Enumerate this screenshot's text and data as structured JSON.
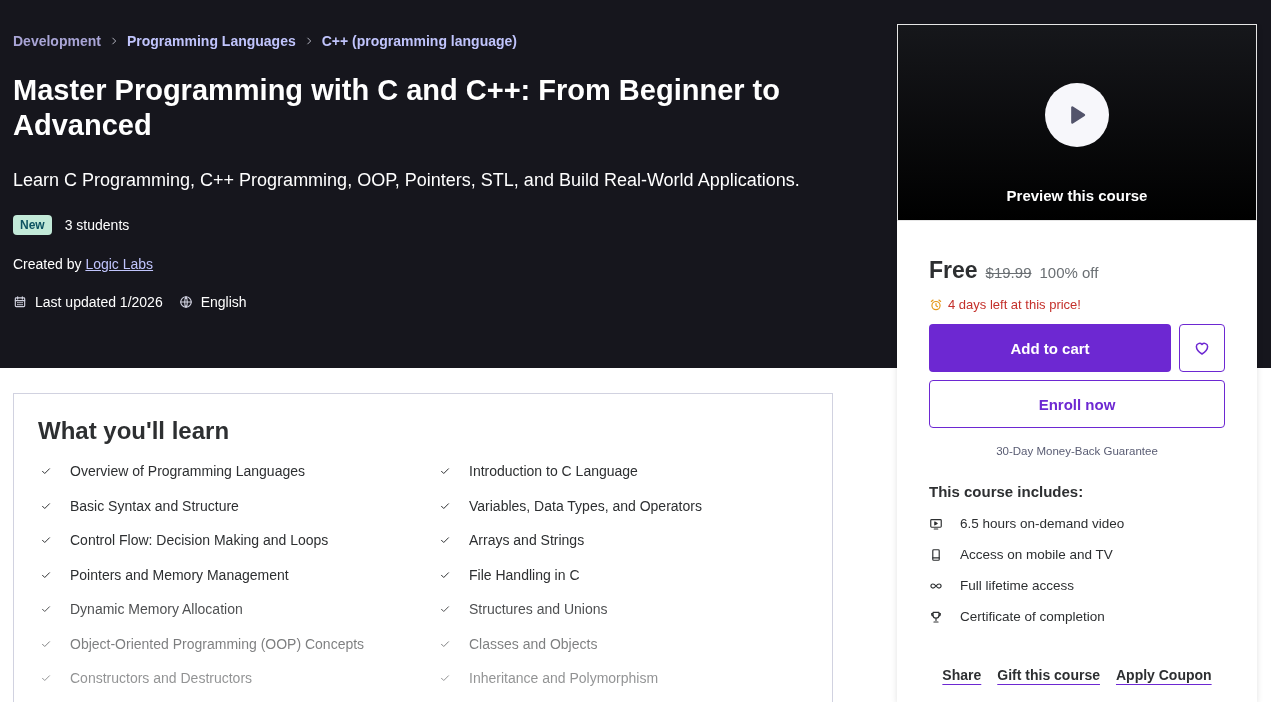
{
  "breadcrumb": [
    {
      "label": "Development"
    },
    {
      "label": "Programming Languages"
    },
    {
      "label": "C++ (programming language)"
    }
  ],
  "title": "Master Programming with C and C++: From Beginner to Advanced",
  "subtitle": "Learn C Programming, C++ Programming, OOP, Pointers, STL, and Build Real-World Applications.",
  "badge": "New",
  "students": "3 students",
  "created_by": {
    "label": "Created by",
    "author": "Logic Labs"
  },
  "meta": {
    "last_updated": "Last updated 1/2026",
    "language": "English"
  },
  "learn": {
    "heading": "What you'll learn",
    "items": [
      {
        "text": "Overview of Programming Languages"
      },
      {
        "text": "Introduction to C Language"
      },
      {
        "text": "Basic Syntax and Structure"
      },
      {
        "text": "Variables, Data Types, and Operators"
      },
      {
        "text": "Control Flow: Decision Making and Loops"
      },
      {
        "text": "Arrays and Strings"
      },
      {
        "text": "Pointers and Memory Management"
      },
      {
        "text": "File Handling in C"
      },
      {
        "text": "Dynamic Memory Allocation"
      },
      {
        "text": "Structures and Unions"
      },
      {
        "text": "Object-Oriented Programming (OOP) Concepts"
      },
      {
        "text": "Classes and Objects"
      },
      {
        "text": "Constructors and Destructors"
      },
      {
        "text": "Inheritance and Polymorphism"
      }
    ]
  },
  "preview": {
    "label": "Preview this course"
  },
  "pricing": {
    "price": "Free",
    "original_price": "$19.99",
    "discount": "100% off",
    "deadline": "4 days left at this price!"
  },
  "buttons": {
    "add_to_cart": "Add to cart",
    "enroll": "Enroll now"
  },
  "guarantee": "30-Day Money-Back Guarantee",
  "includes": {
    "heading": "This course includes:",
    "items": [
      {
        "kind": "video",
        "text": "6.5 hours on-demand video"
      },
      {
        "kind": "mobile",
        "text": "Access on mobile and TV"
      },
      {
        "kind": "lifetime",
        "text": "Full lifetime access"
      },
      {
        "kind": "certificate",
        "text": "Certificate of completion"
      }
    ]
  },
  "links": [
    {
      "label": "Share"
    },
    {
      "label": "Gift this course"
    },
    {
      "label": "Apply Coupon"
    }
  ]
}
